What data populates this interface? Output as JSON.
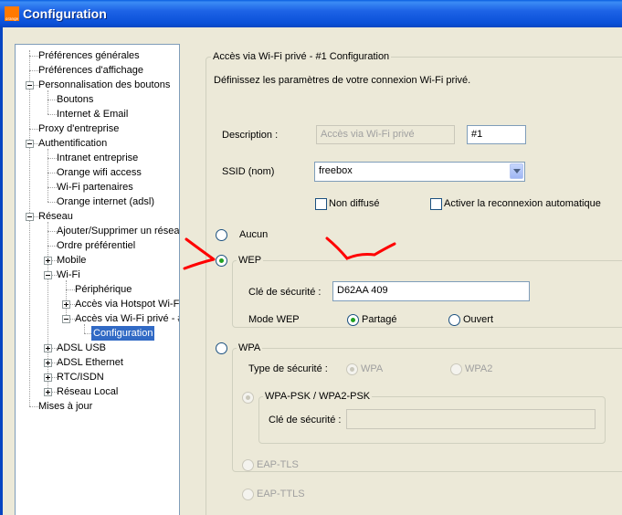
{
  "window": {
    "title": "Configuration",
    "logo_text": "orange"
  },
  "tree": {
    "items": [
      {
        "label": "Préférences générales"
      },
      {
        "label": "Préférences d'affichage"
      },
      {
        "label": "Personnalisation des boutons"
      },
      {
        "label": "Boutons"
      },
      {
        "label": "Internet & Email"
      },
      {
        "label": "Proxy d'entreprise"
      },
      {
        "label": "Authentification"
      },
      {
        "label": "Intranet entreprise"
      },
      {
        "label": "Orange wifi access"
      },
      {
        "label": "Wi-Fi partenaires"
      },
      {
        "label": "Orange internet (adsl)"
      },
      {
        "label": "Réseau"
      },
      {
        "label": "Ajouter/Supprimer un résea"
      },
      {
        "label": "Ordre préférentiel"
      },
      {
        "label": "Mobile"
      },
      {
        "label": "Wi-Fi"
      },
      {
        "label": "Périphérique"
      },
      {
        "label": "Accès via Hotspot Wi-Fi"
      },
      {
        "label": "Accès via Wi-Fi privé - #"
      },
      {
        "label": "Configuration"
      },
      {
        "label": "ADSL USB"
      },
      {
        "label": "ADSL Ethernet"
      },
      {
        "label": "RTC/ISDN"
      },
      {
        "label": "Réseau Local"
      },
      {
        "label": "Mises à jour"
      }
    ]
  },
  "panel": {
    "group_title": "Accès via Wi-Fi privé - #1 Configuration",
    "intro": "Définissez les paramètres de votre connexion Wi-Fi privé.",
    "description_label": "Description :",
    "description_value": "Accès via Wi-Fi privé",
    "description_suffix": "#1",
    "ssid_label": "SSID (nom)",
    "ssid_value": "freebox",
    "non_diffuse_label": "Non diffusé",
    "reconnect_label": "Activer la reconnexion automatique",
    "aucun_label": "Aucun",
    "wep": {
      "legend": "WEP",
      "key_label": "Clé de sécurité :",
      "key_value": "D62AA 409",
      "mode_label": "Mode WEP",
      "partage_label": "Partagé",
      "ouvert_label": "Ouvert"
    },
    "wpa": {
      "legend": "WPA",
      "type_label": "Type de sécurité :",
      "wpa_label": "WPA",
      "wpa2_label": "WPA2",
      "psk_legend": "WPA-PSK / WPA2-PSK",
      "key_label": "Clé de sécurité :",
      "key_value": ""
    },
    "eap_tls_label": "EAP-TLS",
    "eap_ttls_label": "EAP-TTLS"
  },
  "colors": {
    "titlebar": "#0a50d8",
    "selection": "#316ac5",
    "annotation": "#ff0000"
  }
}
